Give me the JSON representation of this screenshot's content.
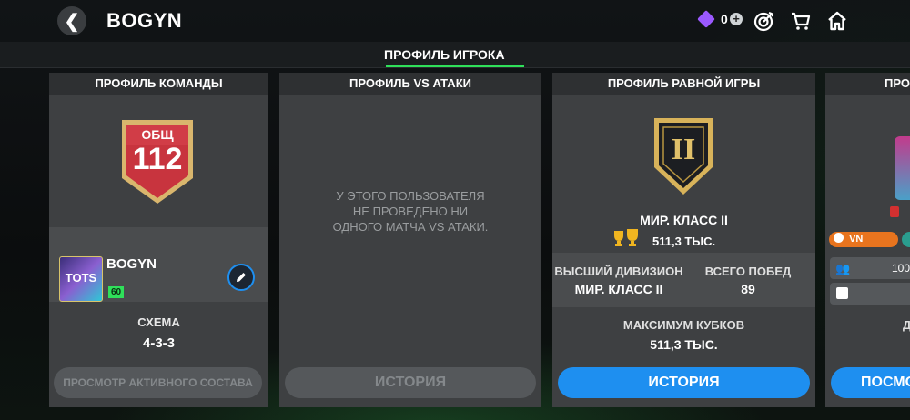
{
  "header": {
    "title": "BOGYN",
    "gem_count": "0"
  },
  "tabs": {
    "active_label": "ПРОФИЛЬ ИГРОКА"
  },
  "team_card": {
    "title": "ПРОФИЛЬ КОМАНДЫ",
    "badge_label": "ОБЩ",
    "badge_value": "112",
    "player_name": "BOGYN",
    "tots_label": "TOTS",
    "level": "60",
    "scheme_label": "СХЕМА",
    "scheme_value": "4-3-3",
    "view_button": "ПРОСМОТР АКТИВНОГО СОСТАВА"
  },
  "vs_card": {
    "title": "ПРОФИЛЬ VS АТАКИ",
    "empty_line1": "У ЭТОГО ПОЛЬЗОВАТЕЛЯ",
    "empty_line2": "НЕ ПРОВЕДЕНО НИ",
    "empty_line3": "ОДНОГО МАТЧА VS АТАКИ.",
    "history_button": "ИСТОРИЯ"
  },
  "equal_card": {
    "title": "ПРОФИЛЬ РАВНОЙ ИГРЫ",
    "rank_numeral": "II",
    "division": "МИР. КЛАСС II",
    "trophies": "511,3 ТЫС.",
    "top_division_label": "ВЫСШИЙ ДИВИЗИОН",
    "top_division_value": "МИР. КЛАСС II",
    "total_wins_label": "ВСЕГО ПОБЕД",
    "total_wins_value": "89",
    "max_cups_label": "МАКСИМУМ КУБКОВ",
    "max_cups_value": "511,3 ТЫС.",
    "history_button": "ИСТОРИЯ"
  },
  "fourth_card": {
    "title_partial": "ПРО",
    "region": "VN",
    "members": "100/",
    "partial_label": "Д",
    "button_partial": "ПОСМО"
  },
  "colors": {
    "accent_green": "#2fe05a",
    "button_blue": "#1e8ff0",
    "badge_red": "#c8343e",
    "card_bg": "#3e4042"
  }
}
